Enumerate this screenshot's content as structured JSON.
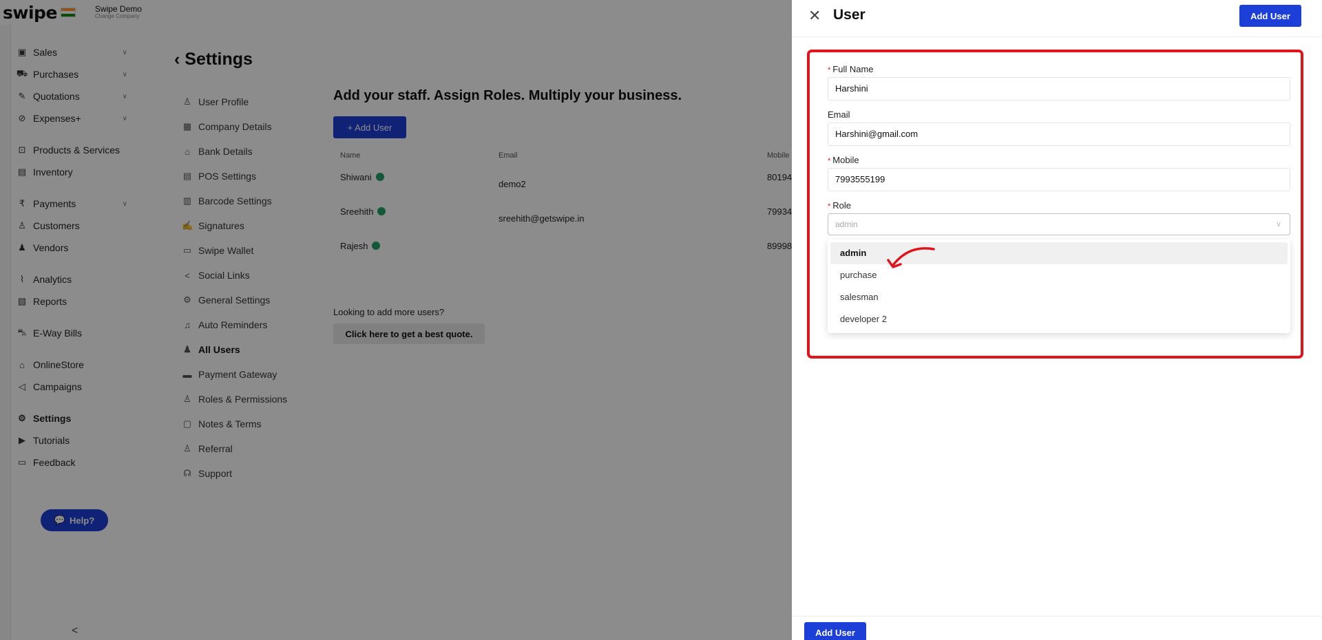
{
  "app": {
    "logo": "swipe",
    "company_name": "Swipe Demo",
    "company_sub": "Change Company"
  },
  "sidebar": {
    "items": [
      {
        "label": "Sales",
        "icon": "sales-icon",
        "glyph": "▣",
        "chevron": true
      },
      {
        "label": "Purchases",
        "icon": "cart-icon",
        "glyph": "⛟",
        "chevron": true
      },
      {
        "label": "Quotations",
        "icon": "pen-icon",
        "glyph": "✎",
        "chevron": true
      },
      {
        "label": "Expenses+",
        "icon": "tag-icon",
        "glyph": "⊘",
        "chevron": true
      },
      {
        "label": "Products & Services",
        "icon": "products-icon",
        "glyph": "⊡",
        "chevron": false
      },
      {
        "label": "Inventory",
        "icon": "inventory-icon",
        "glyph": "▤",
        "chevron": false
      },
      {
        "label": "Payments",
        "icon": "rupee-icon",
        "glyph": "₹",
        "chevron": true
      },
      {
        "label": "Customers",
        "icon": "customer-icon",
        "glyph": "♙",
        "chevron": false
      },
      {
        "label": "Vendors",
        "icon": "vendors-icon",
        "glyph": "♟",
        "chevron": false
      },
      {
        "label": "Analytics",
        "icon": "analytics-icon",
        "glyph": "⌇",
        "chevron": false
      },
      {
        "label": "Reports",
        "icon": "reports-icon",
        "glyph": "▧",
        "chevron": false
      },
      {
        "label": "E-Way Bills",
        "icon": "truck-icon",
        "glyph": "⛍",
        "chevron": false
      },
      {
        "label": "OnlineStore",
        "icon": "store-icon",
        "glyph": "⌂",
        "chevron": false
      },
      {
        "label": "Campaigns",
        "icon": "megaphone-icon",
        "glyph": "◁",
        "chevron": false
      },
      {
        "label": "Settings",
        "icon": "gear-icon",
        "glyph": "⚙",
        "chevron": false
      },
      {
        "label": "Tutorials",
        "icon": "youtube-icon",
        "glyph": "▶",
        "chevron": false
      },
      {
        "label": "Feedback",
        "icon": "feedback-icon",
        "glyph": "▭",
        "chevron": false
      }
    ],
    "help_label": "Help?",
    "collapse_glyph": "<"
  },
  "settings": {
    "title": "Settings",
    "menu": [
      {
        "label": "User Profile",
        "icon": "user-icon",
        "glyph": "♙"
      },
      {
        "label": "Company Details",
        "icon": "building-icon",
        "glyph": "▦"
      },
      {
        "label": "Bank Details",
        "icon": "bank-icon",
        "glyph": "⌂"
      },
      {
        "label": "POS Settings",
        "icon": "pos-icon",
        "glyph": "▤"
      },
      {
        "label": "Barcode Settings",
        "icon": "barcode-icon",
        "glyph": "▥"
      },
      {
        "label": "Signatures",
        "icon": "signature-icon",
        "glyph": "✍"
      },
      {
        "label": "Swipe Wallet",
        "icon": "wallet-icon",
        "glyph": "▭"
      },
      {
        "label": "Social Links",
        "icon": "share-icon",
        "glyph": "<"
      },
      {
        "label": "General Settings",
        "icon": "gear-icon",
        "glyph": "⚙"
      },
      {
        "label": "Auto Reminders",
        "icon": "bell-icon",
        "glyph": "♫"
      },
      {
        "label": "All Users",
        "icon": "users-icon",
        "glyph": "♟"
      },
      {
        "label": "Payment Gateway",
        "icon": "card-icon",
        "glyph": "▬"
      },
      {
        "label": "Roles & Permissions",
        "icon": "roles-icon",
        "glyph": "♙"
      },
      {
        "label": "Notes & Terms",
        "icon": "notes-icon",
        "glyph": "▢"
      },
      {
        "label": "Referral",
        "icon": "referral-icon",
        "glyph": "♙"
      },
      {
        "label": "Support",
        "icon": "headset-icon",
        "glyph": "☊"
      }
    ]
  },
  "main": {
    "heading": "Add your staff. Assign Roles. Multiply your business.",
    "add_user_label": "+ Add User",
    "table": {
      "headers": [
        "Name",
        "Email",
        "Mobile"
      ],
      "rows": [
        {
          "name": "Shiwani",
          "email": "demo2",
          "mobile": "80194"
        },
        {
          "name": "Sreehith",
          "email": "sreehith@getswipe.in",
          "mobile": "79934"
        },
        {
          "name": "Rajesh",
          "email": "",
          "mobile": "89998"
        }
      ]
    },
    "more_users_text": "Looking to add more users?",
    "quote_button": "Click here to get a best quote."
  },
  "drawer": {
    "title": "User",
    "close_glyph": "✕",
    "header_button": "Add User",
    "footer_button": "Add User",
    "form": {
      "full_name_label": "Full Name",
      "full_name_value": "Harshini",
      "email_label": "Email",
      "email_value": "Harshini@gmail.com",
      "mobile_label": "Mobile",
      "mobile_value": "7993555199",
      "role_label": "Role",
      "role_placeholder": "admin",
      "role_options": [
        "admin",
        "purchase",
        "salesman",
        "developer 2"
      ],
      "role_selected": "admin"
    },
    "highlight_color": "#e0141d"
  },
  "colors": {
    "primary": "#1c3fd8",
    "status_green": "#21a366",
    "overlay": "rgba(0,0,0,0.45)"
  }
}
